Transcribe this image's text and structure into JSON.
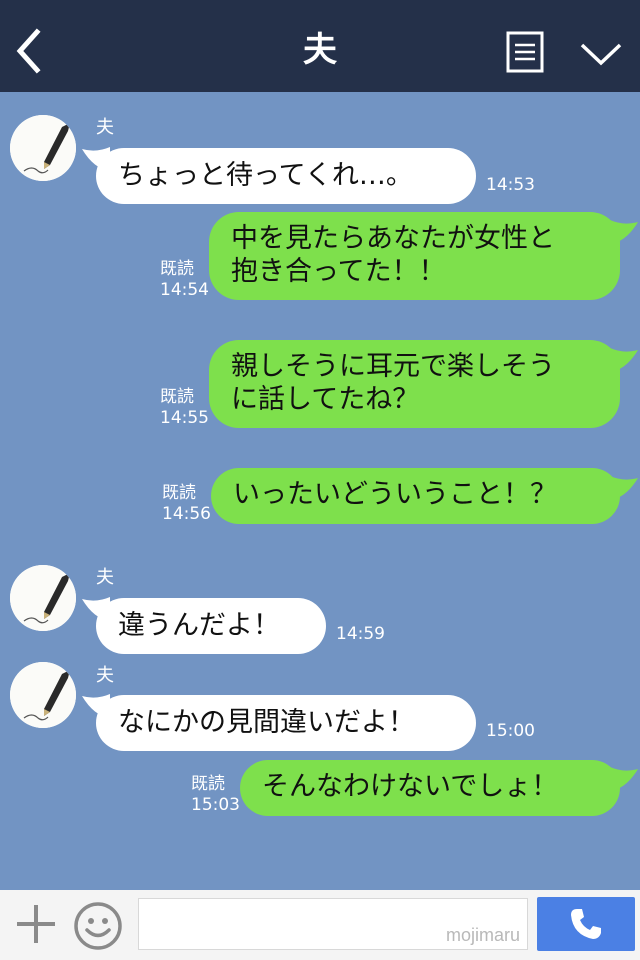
{
  "header": {
    "title": "夫",
    "back_icon": "chevron-left-icon",
    "menu_icon": "note-list-icon",
    "collapse_icon": "chevron-down-icon",
    "background": "#243049"
  },
  "colors": {
    "chat_background": "#7294c3",
    "incoming_bubble": "#ffffff",
    "outgoing_bubble": "#7ee04c",
    "send_button": "#4b80e4"
  },
  "messages": [
    {
      "direction": "in",
      "sender": "夫",
      "lines": [
        "ちょっと待ってくれ…。"
      ],
      "time": "14:53"
    },
    {
      "direction": "out",
      "read": "既読",
      "lines": [
        "中を見たらあなたが女性と",
        "抱き合ってた！！"
      ],
      "time": "14:54"
    },
    {
      "direction": "out",
      "read": "既読",
      "lines": [
        "親しそうに耳元で楽しそう",
        "に話してたね？"
      ],
      "time": "14:55"
    },
    {
      "direction": "out",
      "read": "既読",
      "lines": [
        "いったいどういうこと！？"
      ],
      "time": "14:56"
    },
    {
      "direction": "in",
      "sender": "夫",
      "lines": [
        "違うんだよ！"
      ],
      "time": "14:59"
    },
    {
      "direction": "in",
      "sender": "夫",
      "lines": [
        "なにかの見間違いだよ！"
      ],
      "time": "15:00"
    },
    {
      "direction": "out",
      "read": "既読",
      "lines": [
        "そんなわけないでしょ！"
      ],
      "time": "15:03"
    }
  ],
  "footer": {
    "plus_icon": "plus-icon",
    "emoji_icon": "smiley-icon",
    "input_value": "",
    "watermark": "mojimaru",
    "send_icon": "phone-icon"
  }
}
